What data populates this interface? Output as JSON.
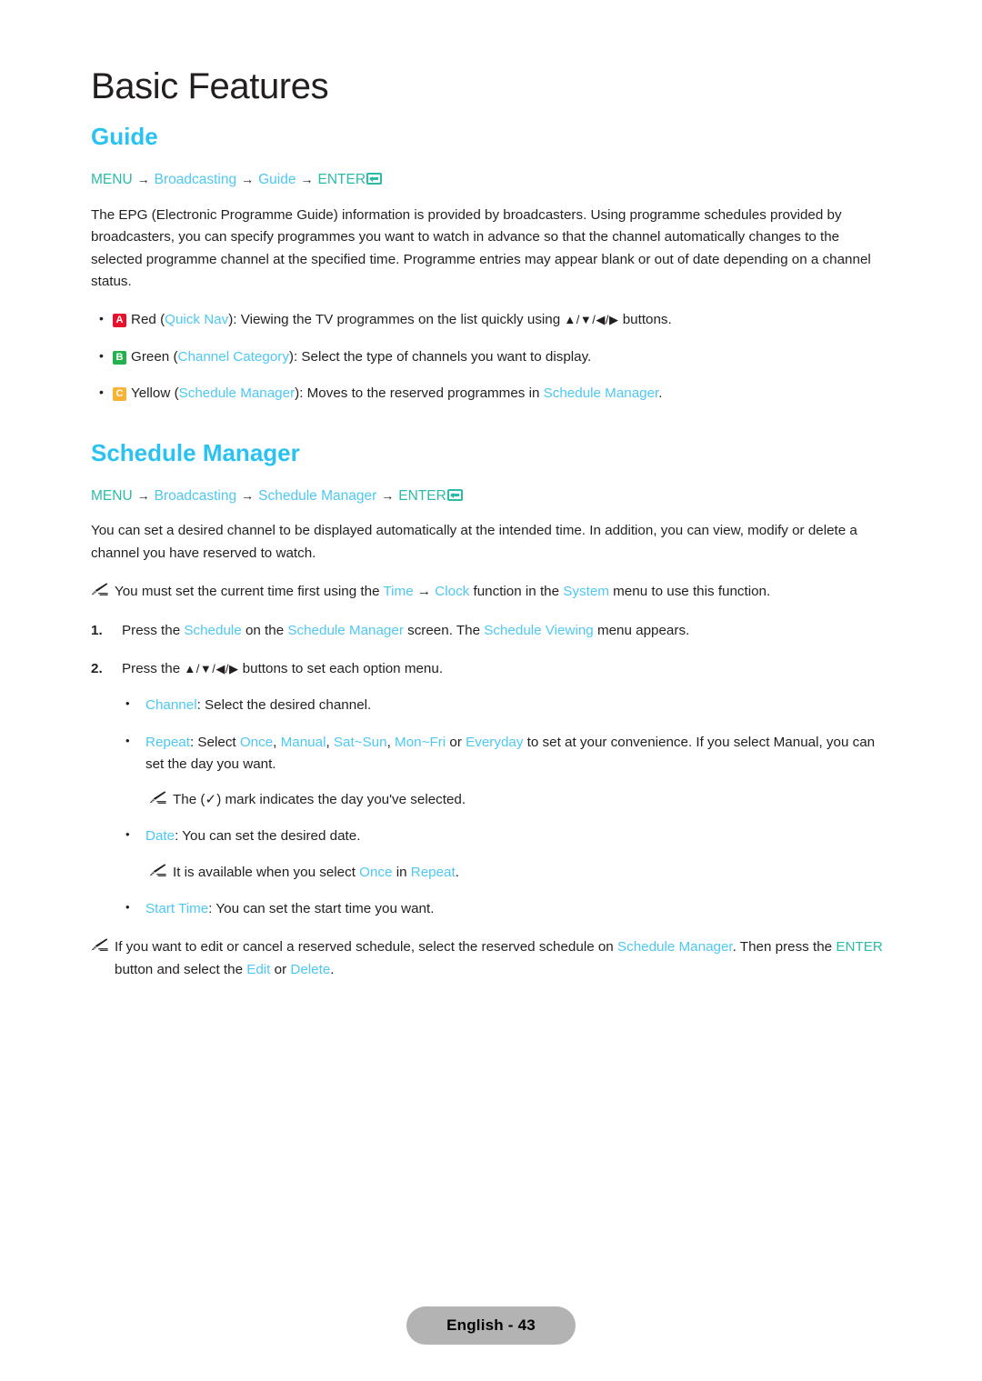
{
  "chapter": {
    "title": "Basic Features"
  },
  "guide": {
    "heading": "Guide",
    "menu_path": {
      "menu": "MENU",
      "arrow": "→",
      "item1": "Broadcasting",
      "item2": "Guide",
      "enter": "ENTER",
      "enter_icon": "enter-return-icon"
    },
    "intro": "The EPG (Electronic Programme Guide) information is provided by broadcasters. Using programme schedules provided by broadcasters, you can specify programmes you want to watch in advance so that the channel automatically changes to the selected programme channel at the specified time. Programme entries may appear blank or out of date depending on a channel status.",
    "bullets": [
      {
        "badge": "A",
        "badge_color": "#e8112d",
        "colour_name": "Red",
        "open_paren": " (",
        "key": "Quick Nav",
        "close_paren": "): ",
        "text_before": "Viewing the TV programmes on the list quickly using ",
        "arrows": "▲/▼/◀/▶",
        "text_after": " buttons."
      },
      {
        "badge": "B",
        "badge_color": "#22b14c",
        "colour_name": "Green",
        "open_paren": " (",
        "key": "Channel Category",
        "close_paren": "): ",
        "text_before": "Select the type of channels you want to display.",
        "arrows": "",
        "text_after": ""
      },
      {
        "badge": "C",
        "badge_color": "#f9b233",
        "colour_name": "Yellow",
        "open_paren": " (",
        "key": "Schedule Manager",
        "close_paren": "): ",
        "text_before": "Moves to the reserved programmes in ",
        "key2": "Schedule Manager",
        "text_after": "."
      }
    ]
  },
  "schedule_manager": {
    "heading": "Schedule Manager",
    "menu_path": {
      "menu": "MENU",
      "arrow": "→",
      "item1": "Broadcasting",
      "item2": "Schedule Manager",
      "enter": "ENTER",
      "enter_icon": "enter-return-icon"
    },
    "intro": "You can set a desired channel to be displayed automatically at the intended time. In addition, you can view, modify or delete a channel you have reserved to watch.",
    "note_time": {
      "icon": "pencil-note-icon",
      "p1": "You must set the current time first using the ",
      "k1": "Time",
      "arrow": " → ",
      "k2": "Clock",
      "p2": " function in the ",
      "k3": "System",
      "p3": " menu to use this function."
    },
    "step1": {
      "number": "1.",
      "p1": "Press the ",
      "k1": "Schedule",
      "p2": " on the ",
      "k2": "Schedule Manager",
      "p3": " screen. The ",
      "k3": "Schedule Viewing",
      "p4": " menu appears."
    },
    "step2": {
      "number": "2.",
      "p1": "Press the ",
      "arrows": "▲/▼/◀/▶",
      "p2": " buttons to set each option menu."
    },
    "sub_channel": {
      "dot": "•",
      "key": "Channel",
      "text": ": Select the desired channel."
    },
    "sub_repeat": {
      "dot": "•",
      "key": "Repeat",
      "p1": ": Select ",
      "o1": "Once",
      "s1": ", ",
      "o2": "Manual",
      "s2": ", ",
      "o3": "Sat~Sun",
      "s3": ", ",
      "o4": "Mon~Fri",
      "s4": " or ",
      "o5": "Everyday",
      "p2": " to set at your convenience. If you select Manual, you can set the day you want."
    },
    "note_checkmark": {
      "icon": "pencil-note-icon",
      "p1": "The (",
      "check": "✓",
      "p2": ") mark indicates the day you've selected."
    },
    "sub_date": {
      "dot": "•",
      "key": "Date",
      "text": ": You can set the desired date."
    },
    "note_date": {
      "icon": "pencil-note-icon",
      "p1": "It is available when you select ",
      "k1": "Once",
      "p2": " in ",
      "k2": "Repeat",
      "p3": "."
    },
    "sub_start_time": {
      "dot": "•",
      "key": "Start Time",
      "text": ": You can set the start time you want."
    },
    "note_edit": {
      "icon": "pencil-note-icon",
      "p1": "If you want to edit or cancel a reserved schedule, select the reserved schedule on ",
      "k1": "Schedule Manager",
      "p2": ". Then press the ",
      "k2": "ENTER",
      "p3": " button and select the ",
      "k3": "Edit",
      "p4": " or ",
      "k4": "Delete",
      "p5": "."
    }
  },
  "footer": {
    "page_label": "English - 43"
  },
  "colors": {
    "heading_blue": "#29c2f2",
    "key_blue": "#4dc8f4",
    "key_teal": "#2bbba6",
    "body_text": "#231f20",
    "badge_red": "#e8112d",
    "badge_green": "#22b14c",
    "badge_yellow": "#f9b233",
    "footer_pill": "#b3b3b3"
  }
}
